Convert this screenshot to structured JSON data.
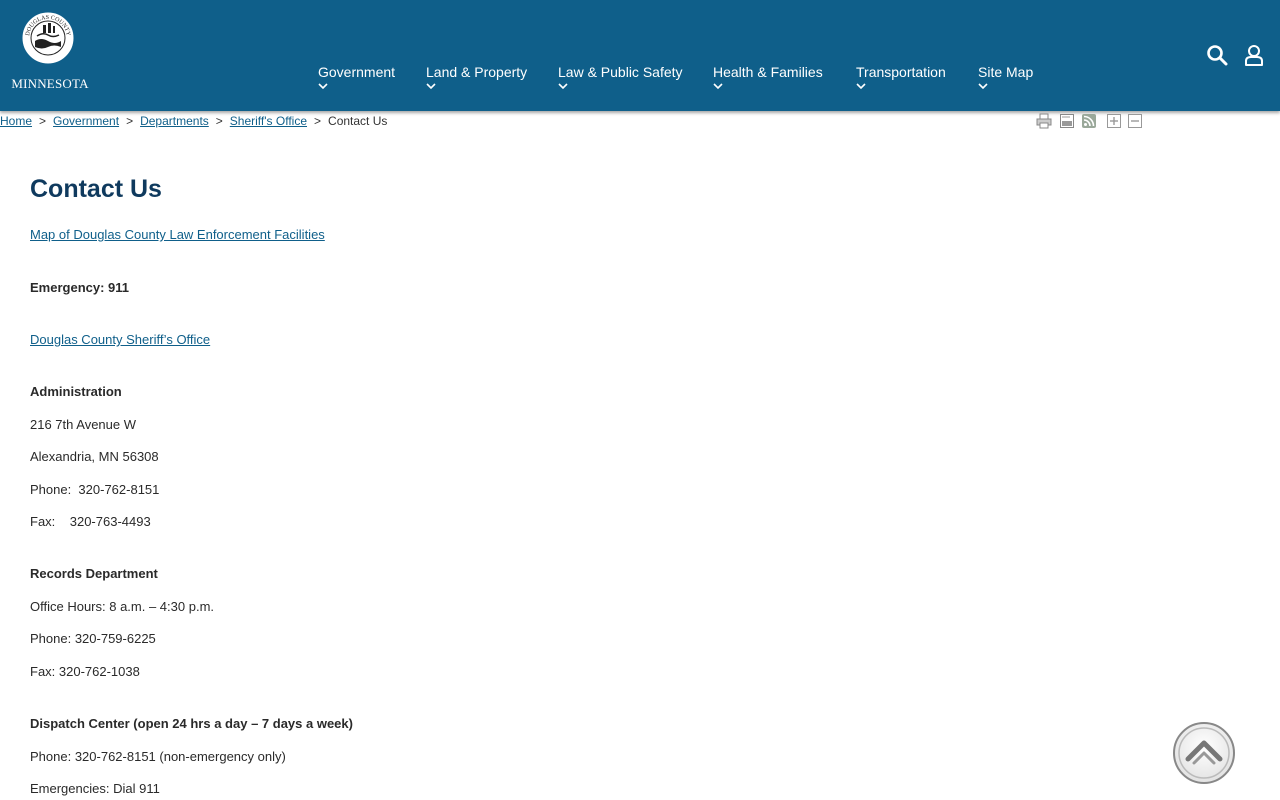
{
  "header": {
    "logo_text": "MINNESOTA",
    "seal_text": "DOUGLAS COUNTY",
    "nav": [
      {
        "label": "Government"
      },
      {
        "label": "Land & Property"
      },
      {
        "label": "Law & Public Safety"
      },
      {
        "label": "Health & Families"
      },
      {
        "label": "Transportation"
      },
      {
        "label": "Site Map"
      }
    ],
    "icons": {
      "search": "search-icon",
      "user": "user-icon"
    },
    "colors": {
      "header_bg": "#0f5f8a",
      "title": "#0f3a5e",
      "link": "#0f5f8a"
    }
  },
  "breadcrumb": {
    "items": [
      "Home",
      "Government",
      "Departments",
      "Sheriff's Office"
    ],
    "current": "Contact Us",
    "separator": ">"
  },
  "tools": [
    "print-icon",
    "email-icon",
    "rss-icon",
    "zoom-in-icon",
    "zoom-out-icon"
  ],
  "main": {
    "title": "Contact Us",
    "map_link": "Map of Douglas County Law Enforcement Facilities",
    "emergency": "Emergency: 911",
    "sheriff_link": "Douglas County Sheriff’s Office",
    "admin": {
      "heading": "Administration",
      "address1": "216 7th Avenue W",
      "address2": "Alexandria, MN 56308",
      "phone": "Phone:  320-762-8151",
      "fax": "Fax:    320-763-4493"
    },
    "records": {
      "heading": "Records Department",
      "hours": "Office Hours: 8 a.m. – 4:30 p.m.",
      "phone": "Phone: 320-759-6225",
      "fax": "Fax: 320-762-1038"
    },
    "dispatch": {
      "heading": "Dispatch Center (open 24 hrs a day – 7 days a week)",
      "phone": "Phone: 320-762-8151 (non-emergency only)",
      "emergencies": "Emergencies: Dial 911"
    }
  }
}
